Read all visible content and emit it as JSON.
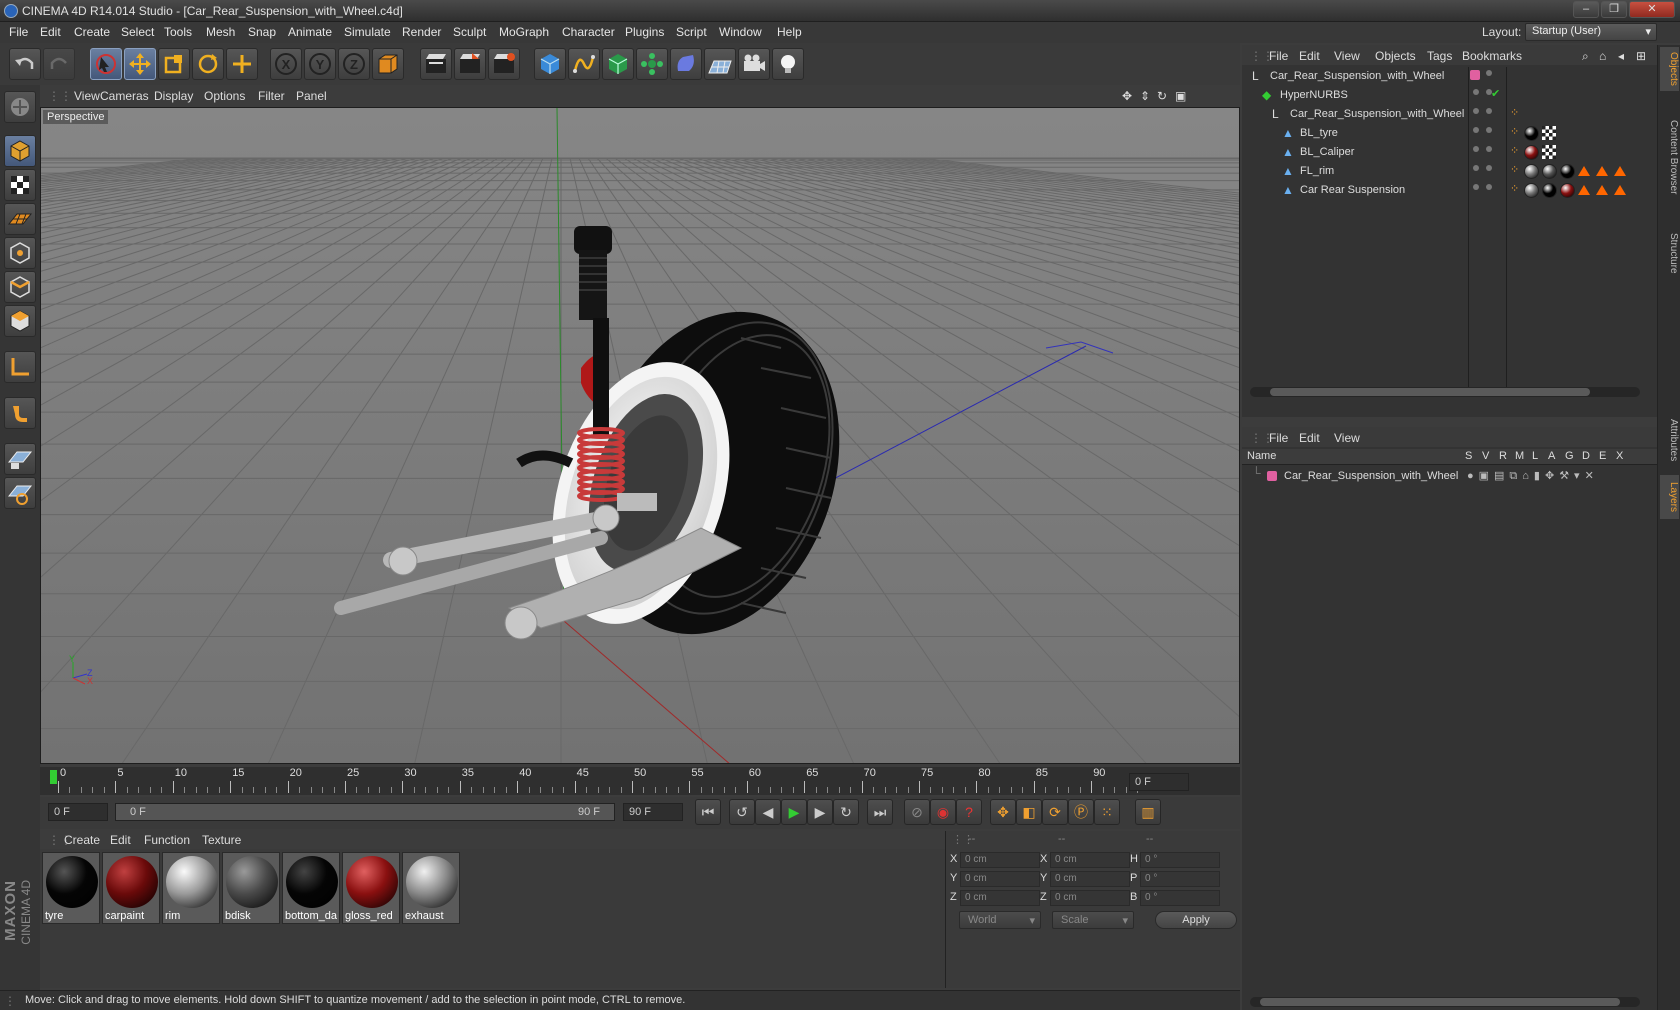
{
  "window": {
    "title": "CINEMA 4D R14.014 Studio - [Car_Rear_Suspension_with_Wheel.c4d]",
    "min_glyph": "–",
    "max_glyph": "❐",
    "close_glyph": "✕"
  },
  "menubar": {
    "items": [
      "File",
      "Edit",
      "Create",
      "Select",
      "Tools",
      "Mesh",
      "Snap",
      "Animate",
      "Simulate",
      "Render",
      "Sculpt",
      "MoGraph",
      "Character",
      "Plugins",
      "Script",
      "Window",
      "Help"
    ],
    "layout_label": "Layout:",
    "layout_value": "Startup (User)"
  },
  "toolbar": {
    "icons": [
      "undo-icon",
      "redo-icon",
      "live-selection-icon",
      "move-icon",
      "scale-icon",
      "rotate-icon",
      "add-icon",
      "x-axis-icon",
      "y-axis-icon",
      "z-axis-icon",
      "coordinate-system-icon",
      "render-view-icon",
      "render-picture-viewer-icon",
      "render-settings-icon",
      "cube-icon",
      "spline-icon",
      "nurbs-icon",
      "array-icon",
      "deformer-icon",
      "floor-icon",
      "camera-icon",
      "light-icon"
    ]
  },
  "lefttools": {
    "icons": [
      "make-editable-icon",
      "model-mode-icon",
      "texture-mode-icon",
      "workplane-icon",
      "points-mode-icon",
      "edges-mode-icon",
      "polygons-mode-icon",
      "axis-mode-icon",
      "snap-icon",
      "workplane-lock-icon",
      "soft-selection-icon"
    ]
  },
  "viewport": {
    "menu": [
      "View",
      "Cameras",
      "Display",
      "Options",
      "Filter",
      "Panel"
    ],
    "label": "Perspective",
    "axis_y": "Y",
    "axis_z": "Z",
    "axis_x": "X",
    "bg_color": "#7b7b7b",
    "grid_color": "#6a6a6a"
  },
  "timeline": {
    "ticks": [
      "0",
      "5",
      "10",
      "15",
      "20",
      "25",
      "30",
      "35",
      "40",
      "45",
      "50",
      "55",
      "60",
      "65",
      "70",
      "75",
      "80",
      "85",
      "90"
    ],
    "current_frame": "0 F"
  },
  "transport": {
    "start_field": "0 F",
    "range_start": "0 F",
    "range_end": "90 F",
    "end_field": "90 F",
    "buttons": [
      "go-to-start-icon",
      "previous-key-icon",
      "previous-frame-icon",
      "play-icon",
      "next-frame-icon",
      "next-key-icon",
      "go-to-end-icon",
      "record-icon",
      "autokey-icon",
      "keyframe-selection-icon",
      "move-key-icon",
      "scale-key-icon",
      "rotate-key-icon",
      "param-key-icon",
      "pla-key-icon",
      "timeline-icon"
    ]
  },
  "materials": {
    "menu": [
      "Create",
      "Edit",
      "Function",
      "Texture"
    ],
    "items": [
      {
        "name": "tyre",
        "color": "#050505",
        "shine": "#555"
      },
      {
        "name": "carpaint",
        "color": "#6a0a0a",
        "shine": "#c04040"
      },
      {
        "name": "rim",
        "color": "#9a9a9a",
        "shine": "#fafafa"
      },
      {
        "name": "bdisk",
        "color": "#4a4a4a",
        "shine": "#9a9a9a"
      },
      {
        "name": "bottom_da",
        "color": "#050505",
        "shine": "#444"
      },
      {
        "name": "gloss_red",
        "color": "#8a1010",
        "shine": "#e06060"
      },
      {
        "name": "exhaust",
        "color": "#8a8a8a",
        "shine": "#f0f0f0"
      }
    ]
  },
  "coords": {
    "headers": [
      "--",
      "--",
      "--"
    ],
    "rows": [
      {
        "a": "X",
        "av": "0 cm",
        "b": "X",
        "bv": "0 cm",
        "c": "H",
        "cv": "0 °"
      },
      {
        "a": "Y",
        "av": "0 cm",
        "b": "Y",
        "bv": "0 cm",
        "c": "P",
        "cv": "0 °"
      },
      {
        "a": "Z",
        "av": "0 cm",
        "b": "Z",
        "bv": "0 cm",
        "c": "B",
        "cv": "0 °"
      }
    ],
    "space": "World",
    "mode": "Scale",
    "apply": "Apply"
  },
  "status": {
    "text": "Move: Click and drag to move elements. Hold down SHIFT to quantize movement / add to the selection in point mode, CTRL to remove."
  },
  "objects": {
    "menu": [
      "File",
      "Edit",
      "View",
      "Objects",
      "Tags",
      "Bookmarks"
    ],
    "rows": [
      {
        "name": "Car_Rear_Suspension_with_Wheel",
        "indent": 0
      },
      {
        "name": "HyperNURBS",
        "indent": 1
      },
      {
        "name": "Car_Rear_Suspension_with_Wheel",
        "indent": 2
      },
      {
        "name": "BL_tyre",
        "indent": 3
      },
      {
        "name": "BL_Caliper",
        "indent": 3
      },
      {
        "name": "FL_rim",
        "indent": 3
      },
      {
        "name": "Car Rear Suspension",
        "indent": 3
      }
    ],
    "layer_color": "#e060a0",
    "check_glyph": "✔"
  },
  "layers": {
    "menu": [
      "File",
      "Edit",
      "View"
    ],
    "columns": [
      "Name",
      "S",
      "V",
      "R",
      "M",
      "L",
      "A",
      "G",
      "D",
      "E",
      "X"
    ],
    "rows": [
      {
        "name": "Car_Rear_Suspension_with_Wheel",
        "color": "#e060a0"
      }
    ]
  },
  "side_tabs": [
    "Objects",
    "Content Browser",
    "Structure",
    "Attributes",
    "Layers"
  ],
  "brand": {
    "maxon": "MAXON",
    "c4d": "CINEMA 4D"
  }
}
